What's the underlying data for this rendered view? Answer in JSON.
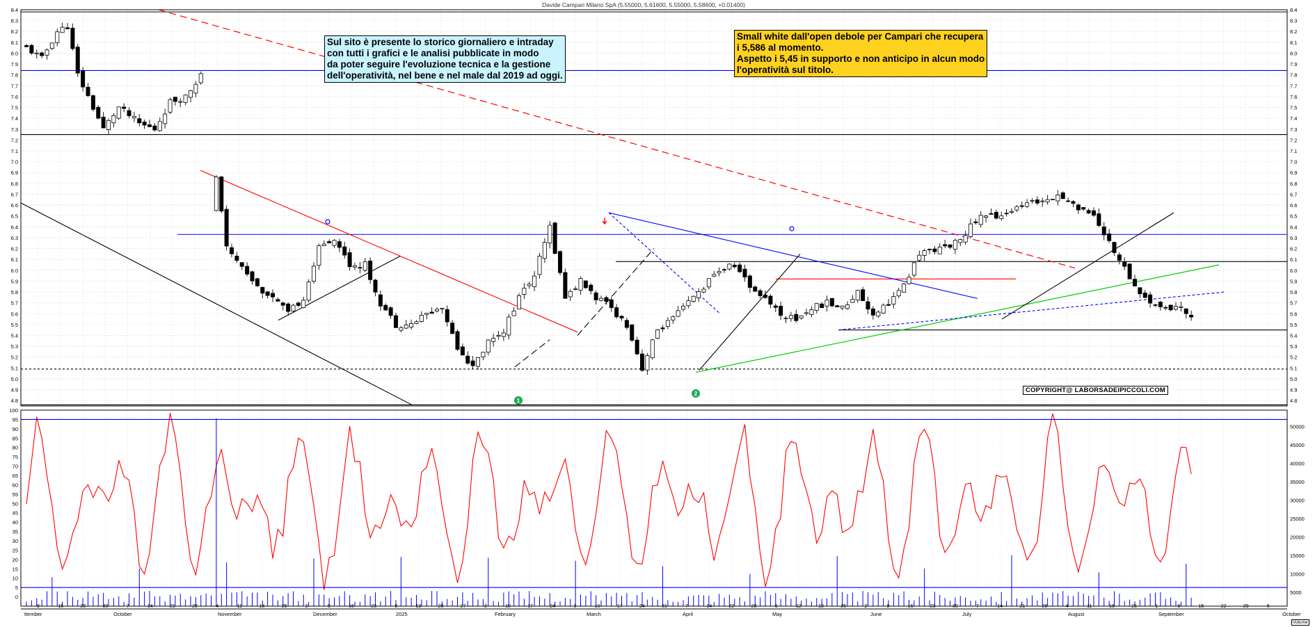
{
  "title": "Davide Campari Milano SpA (5.55000, 5.61600, 5.55000, 5.58600, +0.01400)",
  "colors": {
    "candle": "#000000",
    "resistance_blue": "#0000ff",
    "black_line": "#000000",
    "red_line": "#ff0000",
    "green_line": "#00cc00",
    "oscillator": "#ff0000",
    "volume": "#0000ff",
    "note_left_bg": "#c9f4ff",
    "note_right_bg": "#ffd21f"
  },
  "notes": {
    "left": [
      "Sul sito è presente lo storico giornaliero e intraday",
      "con tutti i grafici e le analisi pubblicate in modo",
      "da poter seguire l'evoluzione tecnica e la gestione",
      "dell'operatività, nel bene e nel male dal 2019 ad oggi."
    ],
    "right": [
      "Small white dall'open debole per Campari che recupera",
      "i 5,586 al momento.",
      "Aspetto i 5,45 in supporto e non anticipo in alcun modo",
      "l'operatività sul titolo."
    ]
  },
  "copyright": "COPYRIGHT@ LABORSADEIPICCOLI.COM",
  "volume_axis_label": "Volume",
  "markers": [
    "1",
    "2"
  ],
  "chart_data": [
    {
      "type": "candlestick",
      "name": "price",
      "ylim": [
        4.75,
        8.4
      ],
      "yticks": [
        4.8,
        4.9,
        5.0,
        5.1,
        5.2,
        5.3,
        5.4,
        5.5,
        5.6,
        5.7,
        5.8,
        5.9,
        6.0,
        6.1,
        6.2,
        6.3,
        6.4,
        6.5,
        6.6,
        6.7,
        6.8,
        6.9,
        7.0,
        7.1,
        7.2,
        7.3,
        7.4,
        7.5,
        7.6,
        7.7,
        7.8,
        7.9,
        8.0,
        8.1,
        8.2,
        8.3,
        8.4
      ],
      "grid": true,
      "keypoints": [
        [
          0,
          8.05
        ],
        [
          3,
          7.95
        ],
        [
          6,
          8.2
        ],
        [
          8,
          8.25
        ],
        [
          10,
          7.8
        ],
        [
          12,
          7.6
        ],
        [
          15,
          7.3
        ],
        [
          18,
          7.5
        ],
        [
          22,
          7.35
        ],
        [
          25,
          7.3
        ],
        [
          28,
          7.55
        ],
        [
          31,
          7.6
        ],
        [
          34,
          7.8
        ],
        [
          37,
          6.85
        ],
        [
          39,
          6.2
        ],
        [
          42,
          6.05
        ],
        [
          45,
          5.85
        ],
        [
          48,
          5.75
        ],
        [
          51,
          5.6
        ],
        [
          54,
          5.75
        ],
        [
          57,
          6.2
        ],
        [
          60,
          6.3
        ],
        [
          63,
          6.05
        ],
        [
          66,
          6.05
        ],
        [
          69,
          5.7
        ],
        [
          72,
          5.5
        ],
        [
          75,
          5.5
        ],
        [
          78,
          5.6
        ],
        [
          81,
          5.65
        ],
        [
          84,
          5.3
        ],
        [
          87,
          5.1
        ],
        [
          90,
          5.35
        ],
        [
          93,
          5.45
        ],
        [
          96,
          5.75
        ],
        [
          99,
          5.95
        ],
        [
          102,
          6.4
        ],
        [
          105,
          5.75
        ],
        [
          108,
          5.9
        ],
        [
          111,
          5.75
        ],
        [
          114,
          5.65
        ],
        [
          117,
          5.5
        ],
        [
          120,
          5.1
        ],
        [
          123,
          5.45
        ],
        [
          126,
          5.55
        ],
        [
          129,
          5.7
        ],
        [
          132,
          5.85
        ],
        [
          135,
          6.0
        ],
        [
          138,
          6.05
        ],
        [
          141,
          5.85
        ],
        [
          144,
          5.75
        ],
        [
          147,
          5.6
        ],
        [
          150,
          5.55
        ],
        [
          153,
          5.65
        ],
        [
          156,
          5.7
        ],
        [
          159,
          5.65
        ],
        [
          162,
          5.8
        ],
        [
          165,
          5.6
        ],
        [
          168,
          5.7
        ],
        [
          171,
          5.85
        ],
        [
          174,
          6.15
        ],
        [
          177,
          6.2
        ],
        [
          180,
          6.2
        ],
        [
          183,
          6.35
        ],
        [
          186,
          6.5
        ],
        [
          189,
          6.5
        ],
        [
          192,
          6.55
        ],
        [
          195,
          6.6
        ],
        [
          198,
          6.65
        ],
        [
          201,
          6.7
        ],
        [
          204,
          6.6
        ],
        [
          207,
          6.55
        ],
        [
          210,
          6.35
        ],
        [
          213,
          6.1
        ],
        [
          216,
          5.85
        ],
        [
          219,
          5.7
        ],
        [
          222,
          5.65
        ],
        [
          225,
          5.65
        ],
        [
          227,
          5.586
        ]
      ],
      "horizontal_levels": [
        8.38,
        7.84,
        7.25,
        6.33,
        6.08,
        5.45,
        5.09,
        4.76
      ],
      "x_month_labels": [
        "ttember",
        "October",
        "November",
        "December",
        "2025",
        "February",
        "March",
        "April",
        "May",
        "June",
        "July",
        "August",
        "September",
        "October"
      ],
      "x_day_labels": [
        "9",
        "16",
        "23",
        "30",
        "7",
        "14",
        "21",
        "28",
        "4",
        "11",
        "18",
        "25",
        "2",
        "9",
        "16",
        "23",
        "6",
        "13",
        "20",
        "27",
        "3",
        "10",
        "17",
        "24",
        "3",
        "10",
        "17",
        "24",
        "31",
        "7",
        "14",
        "22",
        "28",
        "5",
        "12",
        "19",
        "26",
        "2",
        "9",
        "16",
        "23",
        "30",
        "7",
        "14",
        "21",
        "28",
        "4",
        "11",
        "18",
        "25",
        "1",
        "8",
        "15",
        "22",
        "29",
        "6"
      ]
    },
    {
      "type": "line+bar",
      "name": "oscillator_and_volume",
      "left_ylim": [
        -5,
        100
      ],
      "left_yticks": [
        0,
        5,
        10,
        15,
        20,
        25,
        30,
        35,
        40,
        45,
        50,
        55,
        60,
        65,
        70,
        75,
        80,
        85,
        90,
        95,
        100
      ],
      "right_yticks": [
        5000,
        10000,
        15000,
        20000,
        25000,
        30000,
        35000,
        40000,
        45000,
        50000
      ],
      "levels": [
        95,
        5
      ]
    }
  ]
}
